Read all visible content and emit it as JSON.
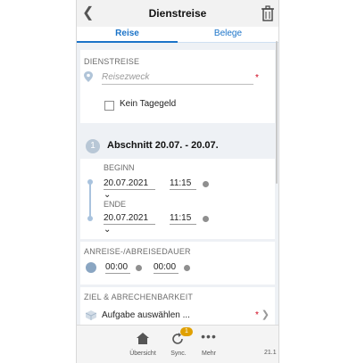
{
  "header": {
    "title": "Dienstreise"
  },
  "tabs": [
    {
      "label": "Reise"
    },
    {
      "label": "Belege"
    }
  ],
  "dienstreise": {
    "section_label": "DIENSTREISE",
    "purpose_placeholder": "Reisezweck",
    "required_mark": "*",
    "no_allowance_label": "Kein Tagegeld"
  },
  "abschnitt": {
    "number": "1",
    "title": "Abschnitt 20.07. - 20.07.",
    "begin_label": "BEGINN",
    "begin_date": "20.07.2021",
    "begin_time": "11:15",
    "end_label": "ENDE",
    "end_date": "20.07.2021",
    "end_time": "11:15"
  },
  "duration": {
    "section_label": "ANREISE-/ABREISEDAUER",
    "arrival": "00:00",
    "departure": "00:00"
  },
  "target": {
    "section_label": "ZIEL & ABRECHENBARKEIT",
    "task_label": "Aufgabe auswählen ...",
    "required_mark": "*"
  },
  "bottom_nav": {
    "overview_label": "Übersicht",
    "sync_label": "Sync.",
    "sync_badge": "1",
    "more_label": "Mehr",
    "version_partial": "21.1"
  },
  "colors": {
    "accent": "#1a73c8",
    "badge": "#e0a000",
    "required": "#d0021b"
  },
  "icons": [
    "back-chevron-icon",
    "trash-icon",
    "location-pin-icon",
    "stopwatch-icon",
    "cube-icon",
    "home-icon",
    "sync-icon",
    "more-dots-icon",
    "chevron-right-icon"
  ]
}
